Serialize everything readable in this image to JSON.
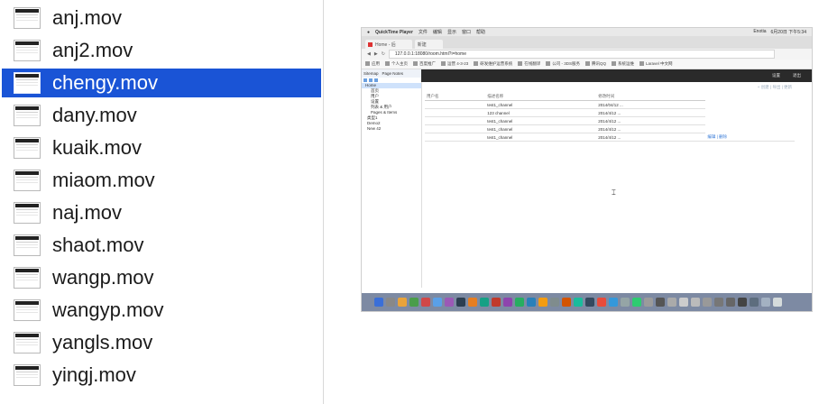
{
  "files": [
    {
      "name": "anj.mov",
      "selected": false
    },
    {
      "name": "anj2.mov",
      "selected": false
    },
    {
      "name": "chengy.mov",
      "selected": true
    },
    {
      "name": "dany.mov",
      "selected": false
    },
    {
      "name": "kuaik.mov",
      "selected": false
    },
    {
      "name": "miaom.mov",
      "selected": false
    },
    {
      "name": "naj.mov",
      "selected": false
    },
    {
      "name": "shaot.mov",
      "selected": false
    },
    {
      "name": "wangp.mov",
      "selected": false
    },
    {
      "name": "wangyp.mov",
      "selected": false
    },
    {
      "name": "yangls.mov",
      "selected": false
    },
    {
      "name": "yingj.mov",
      "selected": false
    }
  ],
  "preview": {
    "menubar": {
      "app_name": "QuickTime Player",
      "items": [
        "文件",
        "编辑",
        "显示",
        "窗口",
        "帮助"
      ],
      "right": [
        "Enotia",
        "6月20日 下午5:34"
      ]
    },
    "tabs": [
      "Home - 后",
      "新建"
    ],
    "url": "127.0.0.1:18080/room.html?i=home",
    "bookmarks": [
      "应用",
      "个人主页",
      "百度推广",
      "运营 4-3-23",
      "研发维护运营系统",
      "在线翻译",
      "公司 - 3DS服务",
      "腾讯QQ",
      "系统运维",
      "Laravel 中文网"
    ],
    "sidebar": {
      "tabs": [
        "Sitemap",
        "Page Notes"
      ],
      "tree": [
        "Home",
        "首页",
        "用户",
        "设置",
        "列表 & 用户",
        "Pages & Items",
        "类型1",
        "Demo2",
        "New 42"
      ]
    },
    "topbar": [
      "设置",
      "退出"
    ],
    "toolbar_text": "+ 创建 | 导出 | 更新",
    "table": {
      "headers": [
        "用户名",
        "描述名称",
        "修改时间"
      ],
      "rows": [
        [
          "",
          "test1_channel",
          "2014/04/12 ..."
        ],
        [
          "",
          "123 channel",
          "2014/4/12 ..."
        ],
        [
          "",
          "test1_channel",
          "2014/4/12 ..."
        ],
        [
          "",
          "test1_channel",
          "2014/4/12 ..."
        ],
        [
          "",
          "test1_channel",
          "2014/4/12 ..."
        ]
      ],
      "row_actions": "编辑 | 删除"
    }
  },
  "colors": {
    "selection": "#1a54d6",
    "dock": "#7d8aa3",
    "topbar": "#2a2a2a"
  }
}
